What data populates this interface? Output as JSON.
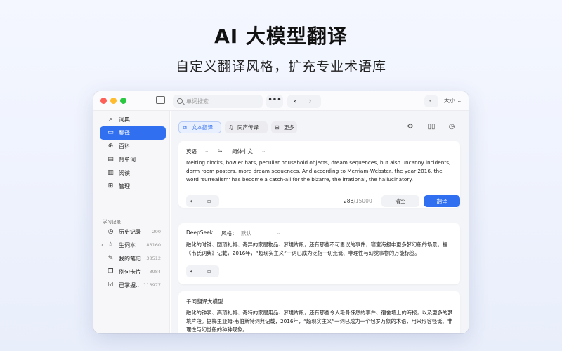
{
  "hero": {
    "title": "AI 大模型翻译",
    "subtitle": "自定义翻译风格，扩充专业术语库"
  },
  "toolbar": {
    "search_placeholder": "单词搜索",
    "more_label": "•••",
    "size_label": "大小",
    "size_caret": "⌄"
  },
  "sidebar": {
    "items": [
      {
        "label": "词典",
        "icon": "search-icon"
      },
      {
        "label": "翻译",
        "icon": "translate-icon",
        "active": true
      },
      {
        "label": "百科",
        "icon": "globe-icon"
      },
      {
        "label": "背单词",
        "icon": "book-icon"
      },
      {
        "label": "阅读",
        "icon": "document-icon"
      },
      {
        "label": "管理",
        "icon": "grid-icon"
      }
    ],
    "section_title": "学习记录",
    "records": [
      {
        "label": "历史记录",
        "count": "200",
        "icon": "clock-icon"
      },
      {
        "label": "生词本",
        "count": "83160",
        "icon": "star-icon"
      },
      {
        "label": "我的笔记",
        "count": "38512",
        "icon": "pen-icon"
      },
      {
        "label": "例句卡片",
        "count": "3984",
        "icon": "cards-icon"
      },
      {
        "label": "已掌握...",
        "count": "113977",
        "icon": "check-calendar-icon"
      }
    ]
  },
  "tabs": [
    {
      "label": "文本翻译",
      "active": true
    },
    {
      "label": "同声传译"
    },
    {
      "label": "更多"
    }
  ],
  "source": {
    "from_lang": "英语",
    "to_lang": "简体中文",
    "swap": "⇋",
    "text": "Melting clocks, bowler hats, peculiar household objects, dream sequences, but also uncanny incidents, dorm room posters, more dream sequences, And according to Merriam-Webster, the year 2016, the word 'surrealism' has become a catch-all for the bizarre, the irrational, the hallucinatory.",
    "char_count": "288",
    "char_max": "/15000",
    "clear_label": "清空",
    "translate_label": "翻译"
  },
  "results": [
    {
      "engine": "DeepSeek",
      "style_label": "风格：",
      "style_value": "默认",
      "text": "融化的时钟、圆顶礼帽、奇异的家居物品、梦境片段，还有那些不可思议的事件，寝室海报中更多梦幻般的场景。据《韦氏词典》记载，2016年，“超现实主义”一词已成为泛指一切荒诞、非理性与幻觉事物的万能标签。"
    },
    {
      "engine": "千问翻译大模型",
      "text": "融化的钟表、高顶礼帽、奇特的家居用品、梦境片段，还有那些令人毛骨悚然的事件、宿舍墙上的海报，以及更多的梦境片段。据梅里亚姆-韦伯斯特词典记载，2016年，“超现实主义”一词已成为一个包罗万象的术语，用来形容怪诞、非理性与幻觉般的种种现象。"
    }
  ]
}
